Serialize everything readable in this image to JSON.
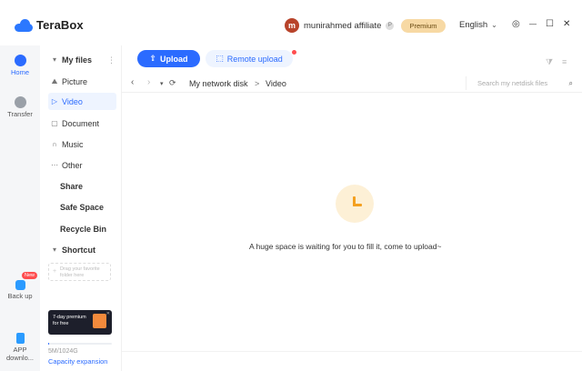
{
  "app": {
    "name": "TeraBox"
  },
  "header": {
    "avatar_letter": "m",
    "username": "munirahmed affiliate",
    "vip_glyph": "P",
    "premium_label": "Premium",
    "language": "English",
    "lang_caret": "⌄",
    "controls": {
      "settings": "◎",
      "minimize": "—",
      "maximize": "☐",
      "close": "✕"
    }
  },
  "rail": {
    "home": "Home",
    "transfer": "Transfer",
    "backup": "Back up",
    "backup_badge": "New",
    "app": [
      "APP",
      "downlo..."
    ]
  },
  "sidebar": {
    "my_files": "My files",
    "items": [
      {
        "label": "Picture",
        "glyph": "⛰"
      },
      {
        "label": "Video",
        "glyph": "▷"
      },
      {
        "label": "Document",
        "glyph": "▢"
      },
      {
        "label": "Music",
        "glyph": "∩"
      },
      {
        "label": "Other",
        "glyph": "⋯"
      }
    ],
    "share": "Share",
    "safe_space": "Safe Space",
    "recycle_bin": "Recycle Bin",
    "shortcut": "Shortcut",
    "drag_hint": "Drag your favorite folder here",
    "promo": [
      "7-day premium",
      "for free"
    ],
    "storage": {
      "text": "5M/1024G",
      "used_fraction": 0.005
    },
    "capacity_link": "Capacity expansion"
  },
  "toolbar": {
    "upload_label": "Upload",
    "remote_label": "Remote upload"
  },
  "path": {
    "back": "‹",
    "forward": "›",
    "dropdown": "▾",
    "refresh": "⟳",
    "root": "My network disk",
    "separator": ">",
    "current": "Video",
    "search_placeholder": "Search my netdisk files"
  },
  "empty_state": {
    "message": "A huge space is waiting for you to fill it, come to upload~"
  },
  "colors": {
    "accent": "#2b6bff",
    "premium_bg": "#f7d9a4",
    "badge_red": "#ff4d4f",
    "empty_icon": "#f4a020"
  }
}
